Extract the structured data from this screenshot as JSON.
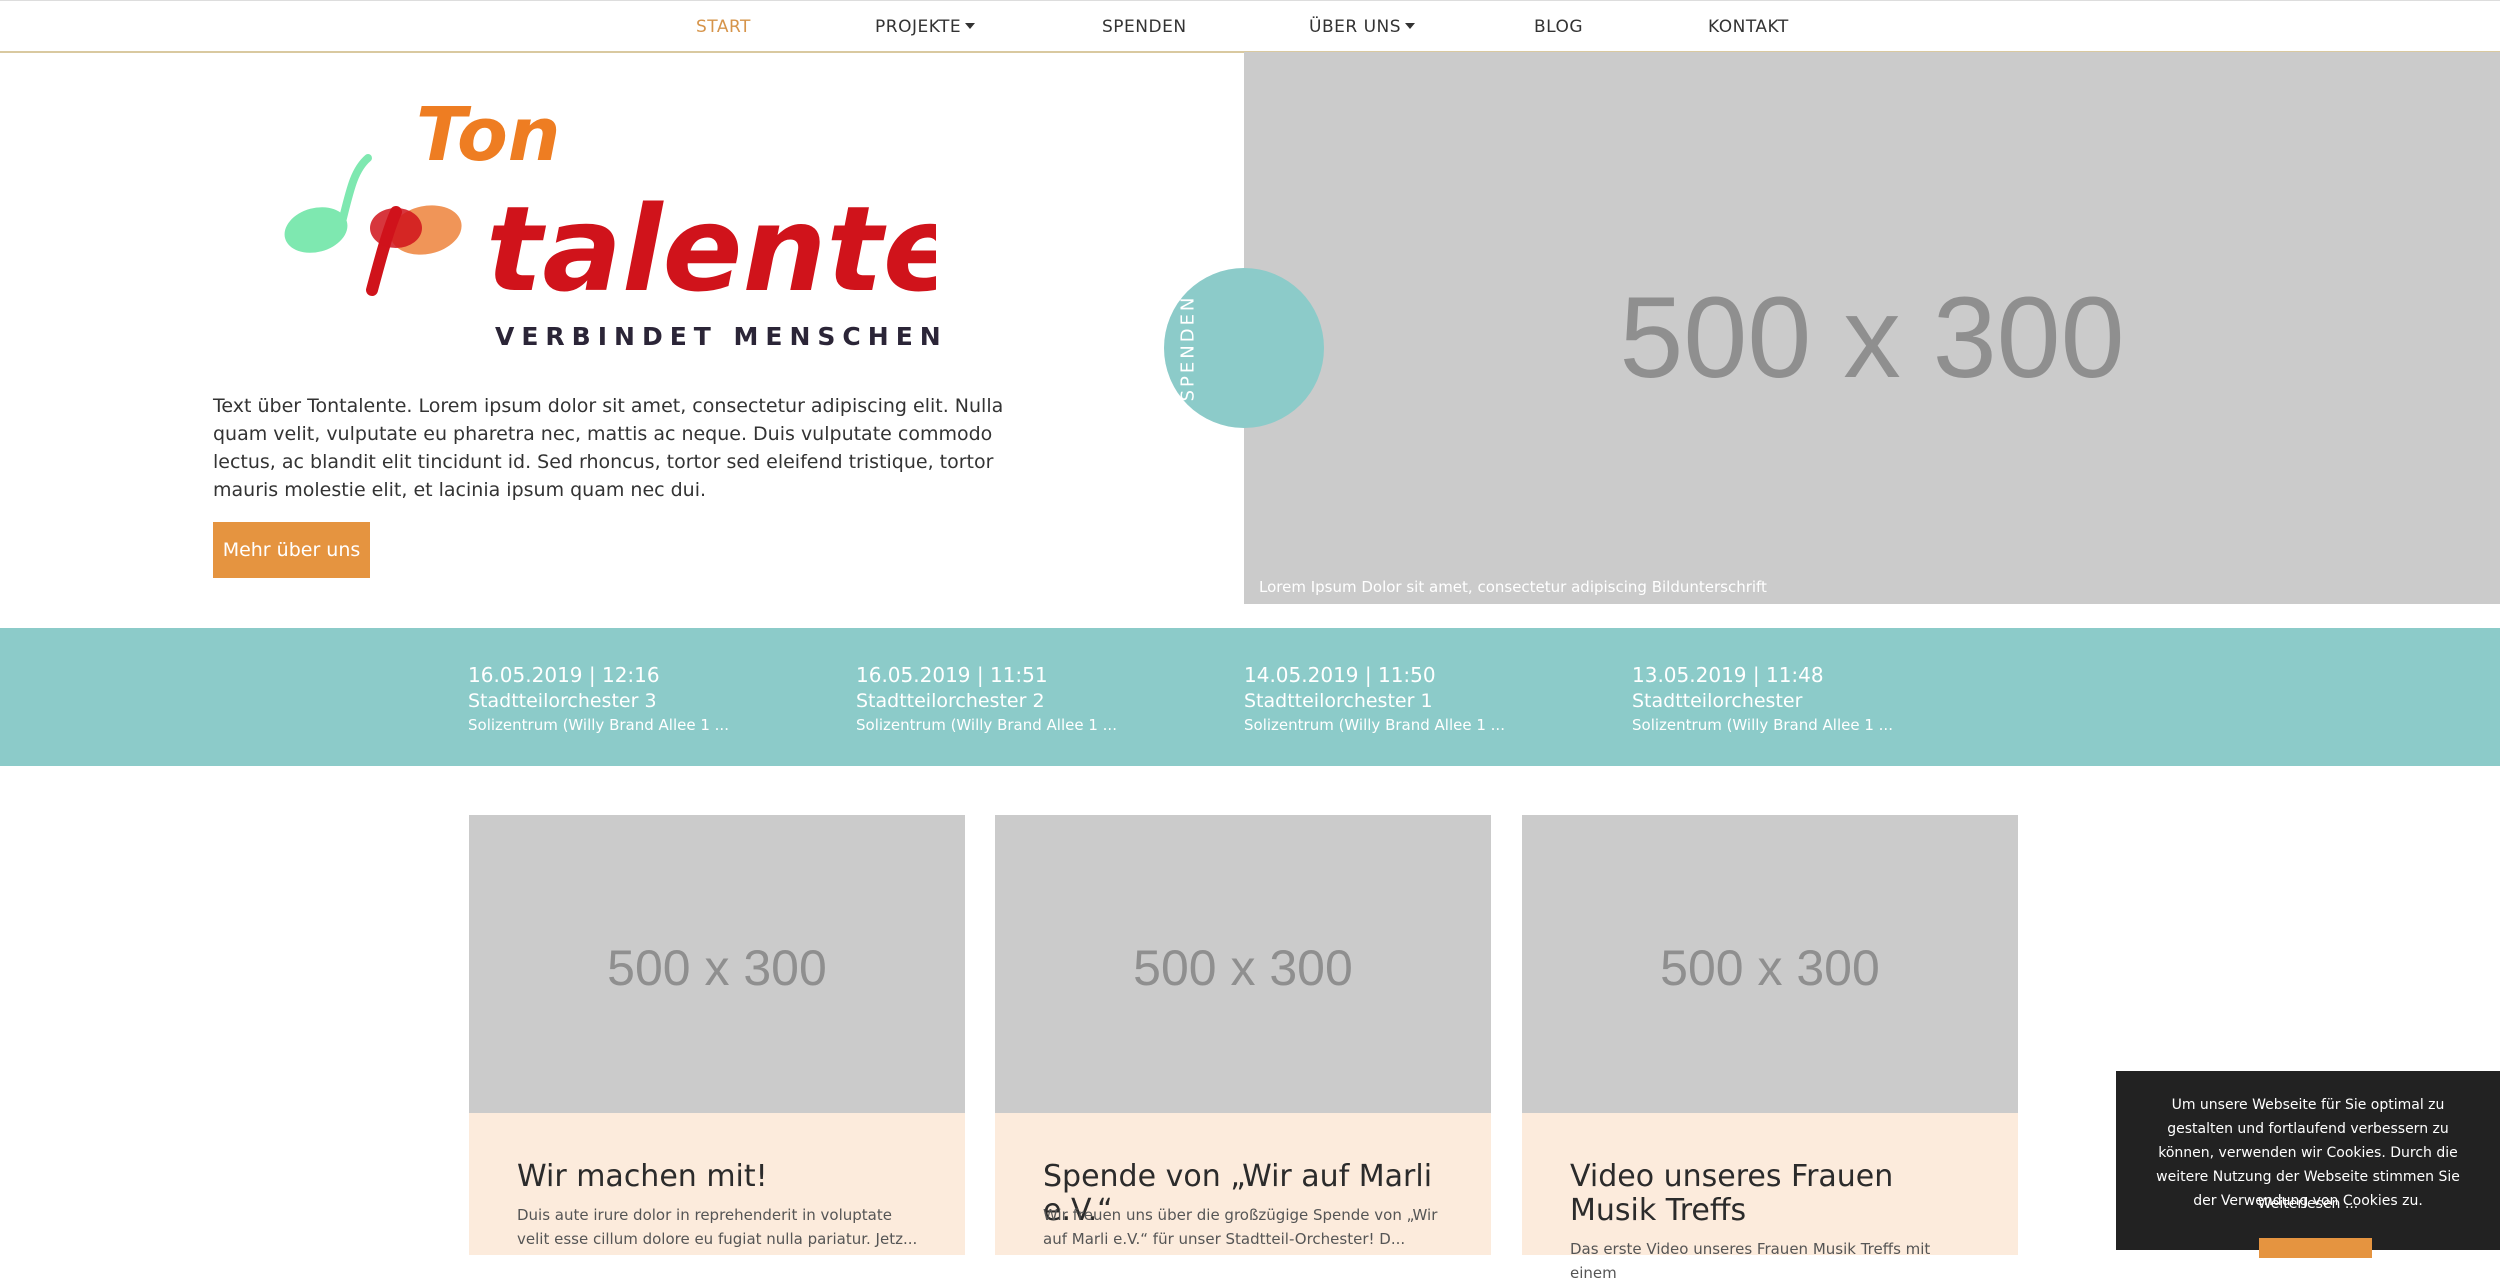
{
  "nav": {
    "items": [
      {
        "label": "START",
        "active": true
      },
      {
        "label": "PROJEKTE",
        "dropdown": true
      },
      {
        "label": "SPENDEN"
      },
      {
        "label": "ÜBER UNS",
        "dropdown": true
      },
      {
        "label": "BLOG"
      },
      {
        "label": "KONTAKT"
      }
    ]
  },
  "logo": {
    "word1": "Ton",
    "word2": "talente",
    "tagline": "VERBINDET MENSCHEN"
  },
  "intro": {
    "text": "Text über Tontalente. Lorem ipsum dolor sit amet, consectetur adipiscing elit. Nulla quam velit, vulputate eu pharetra nec, mattis ac neque. Duis vulputate commodo lectus, ac blandit elit tincidunt id. Sed rhoncus, tortor sed eleifend tristique, tortor mauris molestie elit, et lacinia ipsum quam nec dui.",
    "button": "Mehr über uns"
  },
  "hero": {
    "placeholder": "500 x 300",
    "caption": "Lorem Ipsum Dolor sit amet, consectetur adipiscing Bildunterschrift"
  },
  "donate_tab": "SPENDEN",
  "events": [
    {
      "date": "16.05.2019 | 12:16",
      "title": "Stadtteilorchester 3",
      "place": "Solizentrum (Willy Brand Allee 1 ..."
    },
    {
      "date": "16.05.2019 | 11:51",
      "title": "Stadtteilorchester 2",
      "place": "Solizentrum (Willy Brand Allee 1 ..."
    },
    {
      "date": "14.05.2019 | 11:50",
      "title": "Stadtteilorchester 1",
      "place": "Solizentrum (Willy Brand Allee 1 ..."
    },
    {
      "date": "13.05.2019 | 11:48",
      "title": "Stadtteilorchester",
      "place": "Solizentrum (Willy Brand Allee 1 ..."
    }
  ],
  "cards": [
    {
      "placeholder": "500 x 300",
      "title": "Wir machen mit!",
      "text": "Duis aute irure dolor in reprehenderit in voluptate velit esse cillum dolore eu fugiat nulla pariatur. Jetz..."
    },
    {
      "placeholder": "500 x 300",
      "title": "Spende von „Wir auf Marli e.V.“",
      "text": "Wir freuen uns über die großzügige Spende von „Wir auf Marli e.V.“ für unser Stadtteil-Orchester! D..."
    },
    {
      "placeholder": "500 x 300",
      "title": "Video unseres Frauen Musik Treffs",
      "text": "Das erste Video unseres Frauen Musik Treffs mit einem"
    }
  ],
  "cookie": {
    "text": "Um unsere Webseite für Sie optimal zu gestalten und fortlaufend verbessern zu können, verwenden wir Cookies. Durch die weitere Nutzung der Webseite stimmen Sie der Verwendung von Cookies zu.",
    "more": "Weiterlesen ..."
  },
  "colors": {
    "accent_orange": "#e59440",
    "teal": "#8ccbc9",
    "card_bg": "#fcebdc",
    "placeholder_gray": "#cbcbcb",
    "logo_red": "#d0131b",
    "logo_orange": "#ee7d22",
    "note_green": "#7ee8b0"
  }
}
